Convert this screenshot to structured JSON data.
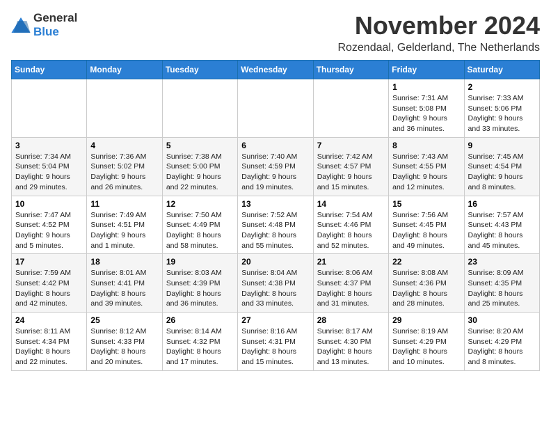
{
  "header": {
    "logo_general": "General",
    "logo_blue": "Blue",
    "month": "November 2024",
    "location": "Rozendaal, Gelderland, The Netherlands"
  },
  "weekdays": [
    "Sunday",
    "Monday",
    "Tuesday",
    "Wednesday",
    "Thursday",
    "Friday",
    "Saturday"
  ],
  "weeks": [
    [
      {
        "day": "",
        "info": ""
      },
      {
        "day": "",
        "info": ""
      },
      {
        "day": "",
        "info": ""
      },
      {
        "day": "",
        "info": ""
      },
      {
        "day": "",
        "info": ""
      },
      {
        "day": "1",
        "info": "Sunrise: 7:31 AM\nSunset: 5:08 PM\nDaylight: 9 hours and 36 minutes."
      },
      {
        "day": "2",
        "info": "Sunrise: 7:33 AM\nSunset: 5:06 PM\nDaylight: 9 hours and 33 minutes."
      }
    ],
    [
      {
        "day": "3",
        "info": "Sunrise: 7:34 AM\nSunset: 5:04 PM\nDaylight: 9 hours and 29 minutes."
      },
      {
        "day": "4",
        "info": "Sunrise: 7:36 AM\nSunset: 5:02 PM\nDaylight: 9 hours and 26 minutes."
      },
      {
        "day": "5",
        "info": "Sunrise: 7:38 AM\nSunset: 5:00 PM\nDaylight: 9 hours and 22 minutes."
      },
      {
        "day": "6",
        "info": "Sunrise: 7:40 AM\nSunset: 4:59 PM\nDaylight: 9 hours and 19 minutes."
      },
      {
        "day": "7",
        "info": "Sunrise: 7:42 AM\nSunset: 4:57 PM\nDaylight: 9 hours and 15 minutes."
      },
      {
        "day": "8",
        "info": "Sunrise: 7:43 AM\nSunset: 4:55 PM\nDaylight: 9 hours and 12 minutes."
      },
      {
        "day": "9",
        "info": "Sunrise: 7:45 AM\nSunset: 4:54 PM\nDaylight: 9 hours and 8 minutes."
      }
    ],
    [
      {
        "day": "10",
        "info": "Sunrise: 7:47 AM\nSunset: 4:52 PM\nDaylight: 9 hours and 5 minutes."
      },
      {
        "day": "11",
        "info": "Sunrise: 7:49 AM\nSunset: 4:51 PM\nDaylight: 9 hours and 1 minute."
      },
      {
        "day": "12",
        "info": "Sunrise: 7:50 AM\nSunset: 4:49 PM\nDaylight: 8 hours and 58 minutes."
      },
      {
        "day": "13",
        "info": "Sunrise: 7:52 AM\nSunset: 4:48 PM\nDaylight: 8 hours and 55 minutes."
      },
      {
        "day": "14",
        "info": "Sunrise: 7:54 AM\nSunset: 4:46 PM\nDaylight: 8 hours and 52 minutes."
      },
      {
        "day": "15",
        "info": "Sunrise: 7:56 AM\nSunset: 4:45 PM\nDaylight: 8 hours and 49 minutes."
      },
      {
        "day": "16",
        "info": "Sunrise: 7:57 AM\nSunset: 4:43 PM\nDaylight: 8 hours and 45 minutes."
      }
    ],
    [
      {
        "day": "17",
        "info": "Sunrise: 7:59 AM\nSunset: 4:42 PM\nDaylight: 8 hours and 42 minutes."
      },
      {
        "day": "18",
        "info": "Sunrise: 8:01 AM\nSunset: 4:41 PM\nDaylight: 8 hours and 39 minutes."
      },
      {
        "day": "19",
        "info": "Sunrise: 8:03 AM\nSunset: 4:39 PM\nDaylight: 8 hours and 36 minutes."
      },
      {
        "day": "20",
        "info": "Sunrise: 8:04 AM\nSunset: 4:38 PM\nDaylight: 8 hours and 33 minutes."
      },
      {
        "day": "21",
        "info": "Sunrise: 8:06 AM\nSunset: 4:37 PM\nDaylight: 8 hours and 31 minutes."
      },
      {
        "day": "22",
        "info": "Sunrise: 8:08 AM\nSunset: 4:36 PM\nDaylight: 8 hours and 28 minutes."
      },
      {
        "day": "23",
        "info": "Sunrise: 8:09 AM\nSunset: 4:35 PM\nDaylight: 8 hours and 25 minutes."
      }
    ],
    [
      {
        "day": "24",
        "info": "Sunrise: 8:11 AM\nSunset: 4:34 PM\nDaylight: 8 hours and 22 minutes."
      },
      {
        "day": "25",
        "info": "Sunrise: 8:12 AM\nSunset: 4:33 PM\nDaylight: 8 hours and 20 minutes."
      },
      {
        "day": "26",
        "info": "Sunrise: 8:14 AM\nSunset: 4:32 PM\nDaylight: 8 hours and 17 minutes."
      },
      {
        "day": "27",
        "info": "Sunrise: 8:16 AM\nSunset: 4:31 PM\nDaylight: 8 hours and 15 minutes."
      },
      {
        "day": "28",
        "info": "Sunrise: 8:17 AM\nSunset: 4:30 PM\nDaylight: 8 hours and 13 minutes."
      },
      {
        "day": "29",
        "info": "Sunrise: 8:19 AM\nSunset: 4:29 PM\nDaylight: 8 hours and 10 minutes."
      },
      {
        "day": "30",
        "info": "Sunrise: 8:20 AM\nSunset: 4:29 PM\nDaylight: 8 hours and 8 minutes."
      }
    ]
  ]
}
